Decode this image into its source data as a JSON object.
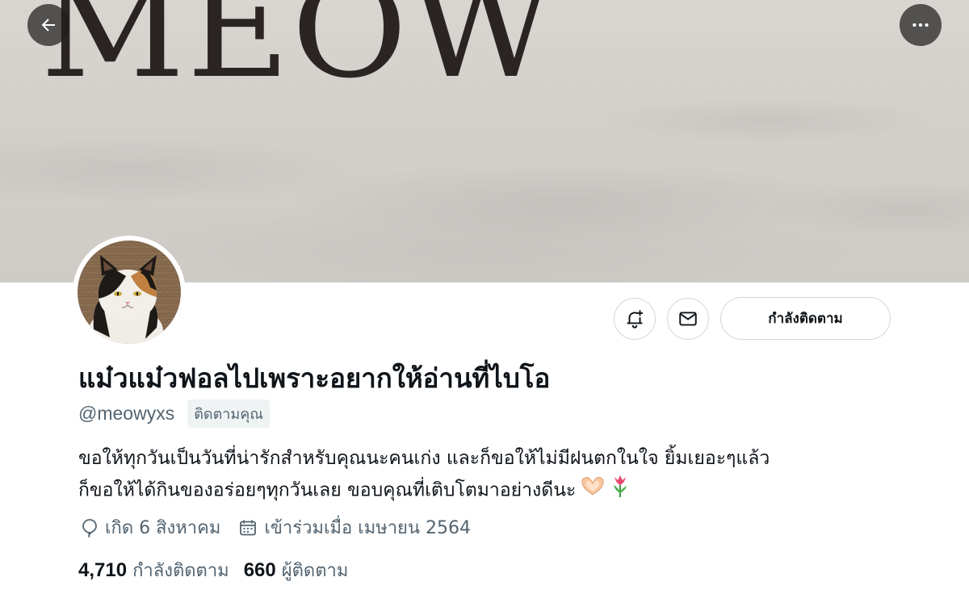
{
  "banner": {
    "text": "MEOW"
  },
  "profile": {
    "display_name": "แม๋วแม๋วฟอลไปเพราะอยากให้อ่านที่ไบโอ",
    "handle": "@meowyxs",
    "follows_you_badge": "ติดตามคุณ",
    "bio_lines": [
      "ขอให้ทุกวันเป็นวันที่น่ารักสำหรับคุณนะคนเก่ง และก็ขอให้ไม่มีฝนตกในใจ ยิ้มเยอะๆแล้ว",
      "ก็ขอให้ได้กินของอร่อยๆทุกวันเลย ขอบคุณที่เติบโตมาอย่างดีนะ"
    ],
    "bio_emojis": [
      "heart-hands-emoji",
      "tulip-emoji"
    ],
    "birthday": "เกิด 6 สิงหาคม",
    "joined": "เข้าร่วมเมื่อ เมษายน 2564"
  },
  "actions": {
    "following_label": "กำลังติดตาม"
  },
  "stats": {
    "following_count": "4,710",
    "following_label": "กำลังติดตาม",
    "followers_count": "660",
    "followers_label": "ผู้ติดตาม"
  },
  "icons": {
    "back": "arrow-left-icon",
    "more": "more-horizontal-icon",
    "notify": "bell-plus-icon",
    "message": "envelope-icon",
    "birthday": "balloon-icon",
    "joined": "calendar-icon"
  },
  "colors": {
    "text_primary": "#0f1419",
    "text_secondary": "#536471",
    "border": "#cfd9de"
  }
}
